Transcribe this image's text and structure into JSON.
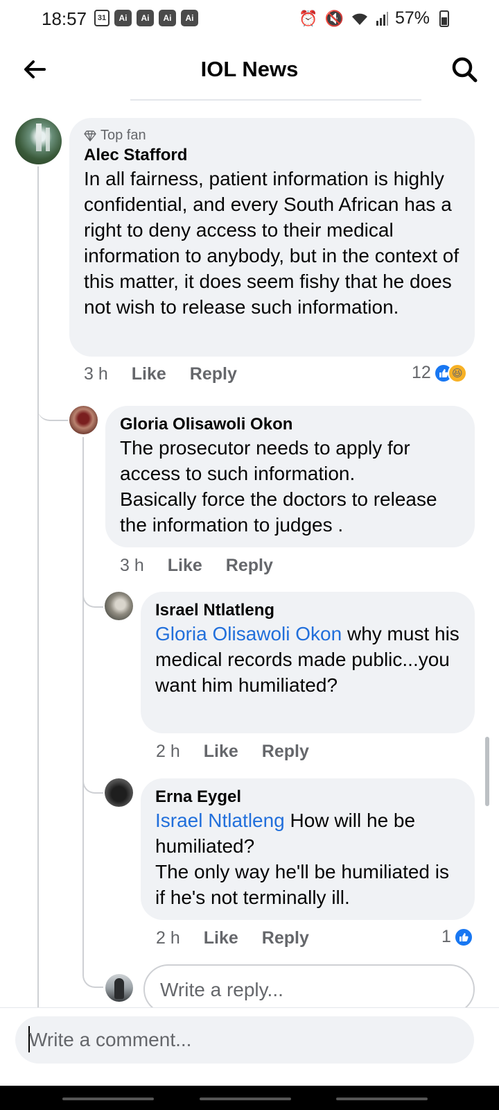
{
  "status_bar": {
    "time": "18:57",
    "calendar_day": "31",
    "ai_badges": [
      "Ai",
      "Ai",
      "Ai",
      "Ai"
    ],
    "battery": "57%"
  },
  "header": {
    "title": "IOL News"
  },
  "comments": {
    "c1": {
      "badge": "Top fan",
      "author": "Alec Stafford",
      "text": "In all fairness, patient information is highly confidential, and every South African has a right to deny access to their medical information to anybody, but in the context of this matter, it does seem fishy that he does not wish to release such information.",
      "time": "3 h",
      "like_label": "Like",
      "reply_label": "Reply",
      "reaction_count": "12"
    },
    "c2": {
      "author": "Gloria Olisawoli Okon",
      "lines": [
        "The prosecutor needs to apply for access to such information.",
        "Basically force the doctors to release the information to judges ."
      ],
      "time": "3 h",
      "like_label": "Like",
      "reply_label": "Reply"
    },
    "c3": {
      "author": "Israel Ntlatleng",
      "mention": "Gloria Olisawoli Okon",
      "text": " why must his medical records made public...you want him humiliated?",
      "time": "2 h",
      "like_label": "Like",
      "reply_label": "Reply"
    },
    "c4": {
      "author": "Erna Eygel",
      "mention": "Israel Ntlatleng",
      "text": " How will he be humiliated?",
      "line2": "The only way he'll be humiliated is if he's not terminally ill.",
      "time": "2 h",
      "like_label": "Like",
      "reply_label": "Reply",
      "reaction_count": "1"
    }
  },
  "reply_input": {
    "placeholder": "Write a reply..."
  },
  "composer": {
    "placeholder": "Write a comment..."
  },
  "colors": {
    "accent": "#1877f2",
    "mention": "#216fdb",
    "bubble": "#f0f2f5"
  }
}
